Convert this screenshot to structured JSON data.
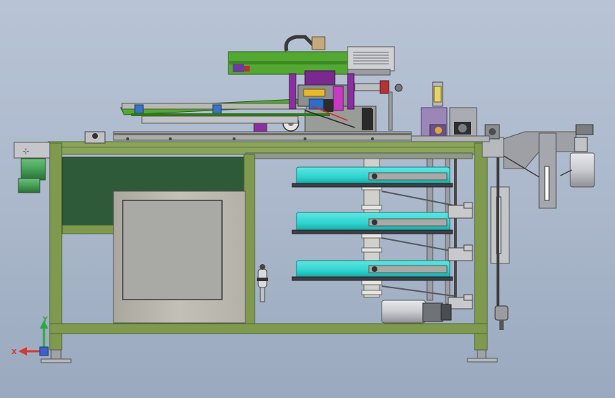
{
  "view": {
    "type": "cad-assembly-front-view",
    "background_colors": [
      "#b8c4d6",
      "#9aa9bf"
    ],
    "colors": {
      "frame": "#7f9a4f",
      "frame_dark": "#4e6630",
      "green_panel": "#2f5a3a",
      "cabinet": "#b9b7ae",
      "cabinet_window": "#a9a9a6",
      "tray_cyan": "#2cd3cf",
      "motor_green": "#45a055",
      "motor_grey": "#d0d2d6",
      "gantry_green": "#52a832",
      "upper_purple": "#8a2fa0",
      "gripper_magenta": "#c73ac2",
      "steel": "#9b9ea4"
    }
  },
  "triad": {
    "x_label": "X",
    "y_label": "Y",
    "x_color": "#d43a2c",
    "y_color": "#2ca842"
  },
  "trays": {
    "count": 3
  }
}
